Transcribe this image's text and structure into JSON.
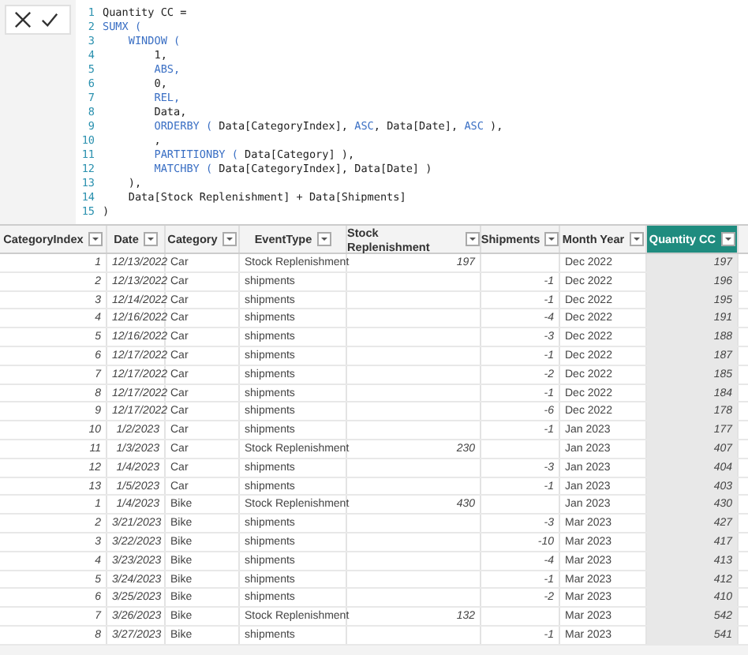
{
  "formula_bar": {
    "code_lines": [
      {
        "number": "1",
        "tokens": [
          {
            "text": "Quantity CC =",
            "kind": "plain"
          }
        ]
      },
      {
        "number": "2",
        "tokens": [
          {
            "text": "SUMX (",
            "kind": "keyword"
          }
        ]
      },
      {
        "number": "3",
        "tokens": [
          {
            "text": "    WINDOW (",
            "kind": "keyword"
          }
        ]
      },
      {
        "number": "4",
        "tokens": [
          {
            "text": "        1,",
            "kind": "plain"
          }
        ]
      },
      {
        "number": "5",
        "tokens": [
          {
            "text": "        ABS,",
            "kind": "keyword"
          }
        ]
      },
      {
        "number": "6",
        "tokens": [
          {
            "text": "        0,",
            "kind": "plain"
          }
        ]
      },
      {
        "number": "7",
        "tokens": [
          {
            "text": "        REL,",
            "kind": "keyword"
          }
        ]
      },
      {
        "number": "8",
        "tokens": [
          {
            "text": "        Data,",
            "kind": "plain"
          }
        ]
      },
      {
        "number": "9",
        "tokens": [
          {
            "text": "        ORDERBY (",
            "kind": "keyword"
          },
          {
            "text": " Data[CategoryIndex], ",
            "kind": "plain"
          },
          {
            "text": "ASC",
            "kind": "keyword"
          },
          {
            "text": ", Data[Date], ",
            "kind": "plain"
          },
          {
            "text": "ASC",
            "kind": "keyword"
          },
          {
            "text": " ),",
            "kind": "plain"
          }
        ]
      },
      {
        "number": "10",
        "tokens": [
          {
            "text": "        ,",
            "kind": "plain"
          }
        ]
      },
      {
        "number": "11",
        "tokens": [
          {
            "text": "        PARTITIONBY (",
            "kind": "keyword"
          },
          {
            "text": " Data[Category] ),",
            "kind": "plain"
          }
        ]
      },
      {
        "number": "12",
        "tokens": [
          {
            "text": "        MATCHBY (",
            "kind": "keyword"
          },
          {
            "text": " Data[CategoryIndex], Data[Date] )",
            "kind": "plain"
          }
        ]
      },
      {
        "number": "13",
        "tokens": [
          {
            "text": "    ),",
            "kind": "plain"
          }
        ]
      },
      {
        "number": "14",
        "tokens": [
          {
            "text": "    Data[Stock Replenishment] + Data[Shipments]",
            "kind": "plain"
          }
        ]
      },
      {
        "number": "15",
        "tokens": [
          {
            "text": ")",
            "kind": "plain"
          }
        ]
      }
    ]
  },
  "table": {
    "columns": [
      {
        "label": "CategoryIndex",
        "kind": "number",
        "selected": false
      },
      {
        "label": "Date",
        "kind": "number",
        "selected": false
      },
      {
        "label": "Category",
        "kind": "text",
        "selected": false
      },
      {
        "label": "EventType",
        "kind": "text",
        "selected": false
      },
      {
        "label": "Stock Replenishment",
        "kind": "number",
        "selected": false
      },
      {
        "label": "Shipments",
        "kind": "number",
        "selected": false
      },
      {
        "label": "Month Year",
        "kind": "text",
        "selected": false
      },
      {
        "label": "Quantity CC",
        "kind": "number",
        "selected": true
      }
    ],
    "rows": [
      [
        "1",
        "12/13/2022",
        "Car",
        "Stock Replenishment",
        "197",
        null,
        "Dec 2022",
        "197"
      ],
      [
        "2",
        "12/13/2022",
        "Car",
        "shipments",
        null,
        "-1",
        "Dec 2022",
        "196"
      ],
      [
        "3",
        "12/14/2022",
        "Car",
        "shipments",
        null,
        "-1",
        "Dec 2022",
        "195"
      ],
      [
        "4",
        "12/16/2022",
        "Car",
        "shipments",
        null,
        "-4",
        "Dec 2022",
        "191"
      ],
      [
        "5",
        "12/16/2022",
        "Car",
        "shipments",
        null,
        "-3",
        "Dec 2022",
        "188"
      ],
      [
        "6",
        "12/17/2022",
        "Car",
        "shipments",
        null,
        "-1",
        "Dec 2022",
        "187"
      ],
      [
        "7",
        "12/17/2022",
        "Car",
        "shipments",
        null,
        "-2",
        "Dec 2022",
        "185"
      ],
      [
        "8",
        "12/17/2022",
        "Car",
        "shipments",
        null,
        "-1",
        "Dec 2022",
        "184"
      ],
      [
        "9",
        "12/17/2022",
        "Car",
        "shipments",
        null,
        "-6",
        "Dec 2022",
        "178"
      ],
      [
        "10",
        "1/2/2023",
        "Car",
        "shipments",
        null,
        "-1",
        "Jan 2023",
        "177"
      ],
      [
        "11",
        "1/3/2023",
        "Car",
        "Stock Replenishment",
        "230",
        null,
        "Jan 2023",
        "407"
      ],
      [
        "12",
        "1/4/2023",
        "Car",
        "shipments",
        null,
        "-3",
        "Jan 2023",
        "404"
      ],
      [
        "13",
        "1/5/2023",
        "Car",
        "shipments",
        null,
        "-1",
        "Jan 2023",
        "403"
      ],
      [
        "1",
        "1/4/2023",
        "Bike",
        "Stock Replenishment",
        "430",
        null,
        "Jan 2023",
        "430"
      ],
      [
        "2",
        "3/21/2023",
        "Bike",
        "shipments",
        null,
        "-3",
        "Mar 2023",
        "427"
      ],
      [
        "3",
        "3/22/2023",
        "Bike",
        "shipments",
        null,
        "-10",
        "Mar 2023",
        "417"
      ],
      [
        "4",
        "3/23/2023",
        "Bike",
        "shipments",
        null,
        "-4",
        "Mar 2023",
        "413"
      ],
      [
        "5",
        "3/24/2023",
        "Bike",
        "shipments",
        null,
        "-1",
        "Mar 2023",
        "412"
      ],
      [
        "6",
        "3/25/2023",
        "Bike",
        "shipments",
        null,
        "-2",
        "Mar 2023",
        "410"
      ],
      [
        "7",
        "3/26/2023",
        "Bike",
        "Stock Replenishment",
        "132",
        null,
        "Mar 2023",
        "542"
      ],
      [
        "8",
        "3/27/2023",
        "Bike",
        "shipments",
        null,
        "-1",
        "Mar 2023",
        "541"
      ]
    ]
  }
}
